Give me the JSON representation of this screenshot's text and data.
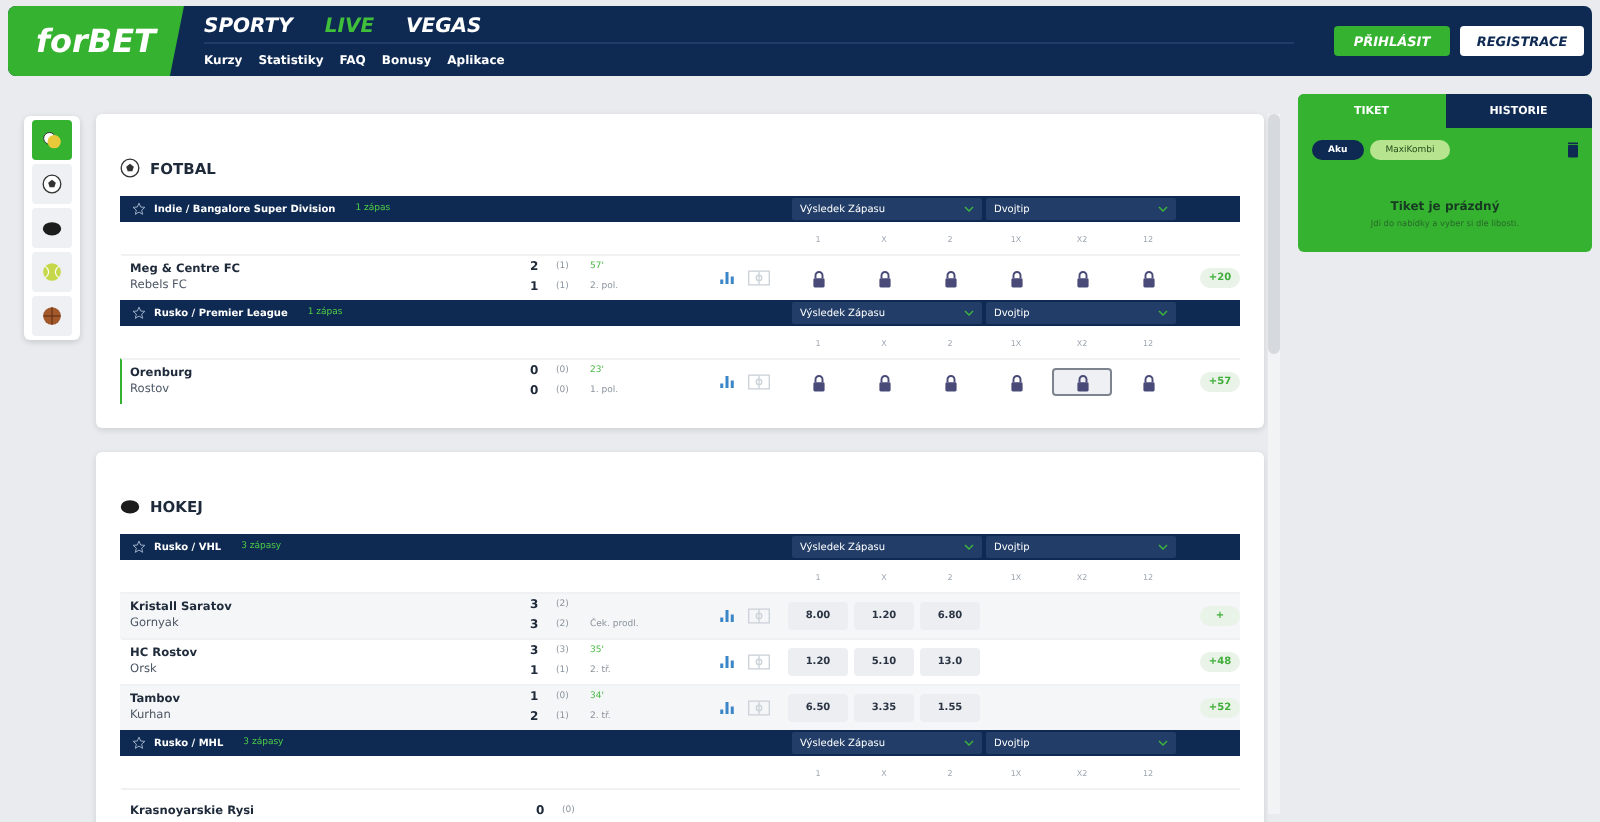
{
  "header": {
    "logo": "forBET",
    "nav": [
      {
        "label": "SPORTY",
        "selected": false
      },
      {
        "label": "LIVE",
        "selected": true
      },
      {
        "label": "VEGAS",
        "selected": false
      }
    ],
    "subnav": [
      "Kurzy",
      "Statistiky",
      "FAQ",
      "Bonusy",
      "Aplikace"
    ],
    "login": "PŘIHLÁSIT",
    "register": "REGISTRACE"
  },
  "sport_menu": [
    {
      "kind": "mixed",
      "selected": true
    },
    {
      "kind": "football",
      "selected": false
    },
    {
      "kind": "hockey",
      "selected": false
    },
    {
      "kind": "tennis",
      "selected": false
    },
    {
      "kind": "basketball",
      "selected": false
    }
  ],
  "sports": [
    {
      "name": "FOTBAL",
      "kind": "football",
      "leagues": [
        {
          "name": "Indie / Bangalore Super Division",
          "count": "1 zápas",
          "markets": [
            "Výsledek Zápasu",
            "Dvojtip"
          ],
          "columns": [
            "1",
            "X",
            "2",
            "1X",
            "X2",
            "12"
          ],
          "matches": [
            {
              "home": "Meg & Centre FC",
              "away": "Rebels FC",
              "home_score": "2",
              "away_score": "1",
              "home_period": "(1)",
              "away_period": "(1)",
              "time": "57'",
              "status": "2. pol.",
              "selected": false,
              "more": "+20",
              "odds": [
                {
                  "kind": "locked",
                  "selected": false
                },
                {
                  "kind": "locked",
                  "selected": false
                },
                {
                  "kind": "locked",
                  "selected": false
                },
                {
                  "kind": "locked",
                  "selected": false
                },
                {
                  "kind": "locked",
                  "selected": false
                },
                {
                  "kind": "locked",
                  "selected": false
                }
              ]
            }
          ]
        },
        {
          "name": "Rusko / Premier League",
          "count": "1 zápas",
          "markets": [
            "Výsledek Zápasu",
            "Dvojtip"
          ],
          "columns": [
            "1",
            "X",
            "2",
            "1X",
            "X2",
            "12"
          ],
          "matches": [
            {
              "home": "Orenburg",
              "away": "Rostov",
              "home_score": "0",
              "away_score": "0",
              "home_period": "(0)",
              "away_period": "(0)",
              "time": "23'",
              "status": "1. pol.",
              "selected": true,
              "more": "+57",
              "odds": [
                {
                  "kind": "locked",
                  "selected": false
                },
                {
                  "kind": "locked",
                  "selected": false
                },
                {
                  "kind": "locked",
                  "selected": false
                },
                {
                  "kind": "locked",
                  "selected": false
                },
                {
                  "kind": "locked",
                  "selected": true
                },
                {
                  "kind": "locked",
                  "selected": false
                }
              ]
            }
          ]
        }
      ]
    },
    {
      "name": "HOKEJ",
      "kind": "hockey",
      "leagues": [
        {
          "name": "Rusko / VHL",
          "count": "3 zápasy",
          "markets": [
            "Výsledek Zápasu",
            "Dvojtip"
          ],
          "columns": [
            "1",
            "X",
            "2",
            "1X",
            "X2",
            "12"
          ],
          "matches": [
            {
              "home": "Kristall Saratov",
              "away": "Gornyak",
              "home_score": "3",
              "away_score": "3",
              "home_period": "(2)",
              "away_period": "(2)",
              "status": "Ček. prodl.",
              "selected": false,
              "more": "+",
              "odds": [
                {
                  "kind": "price",
                  "value": "8.00",
                  "selected": false
                },
                {
                  "kind": "price",
                  "value": "1.20",
                  "selected": false
                },
                {
                  "kind": "price",
                  "value": "6.80",
                  "selected": false
                },
                {
                  "kind": "empty"
                },
                {
                  "kind": "empty"
                },
                {
                  "kind": "empty"
                }
              ]
            },
            {
              "home": "HC Rostov",
              "away": "Orsk",
              "home_score": "3",
              "away_score": "1",
              "home_period": "(3)",
              "away_period": "(1)",
              "time": "35'",
              "status": "2. tř.",
              "selected": false,
              "more": "+48",
              "odds": [
                {
                  "kind": "price",
                  "value": "1.20",
                  "selected": false
                },
                {
                  "kind": "price",
                  "value": "5.10",
                  "selected": false
                },
                {
                  "kind": "price",
                  "value": "13.0",
                  "selected": false
                },
                {
                  "kind": "empty"
                },
                {
                  "kind": "empty"
                },
                {
                  "kind": "empty"
                }
              ]
            },
            {
              "home": "Tambov",
              "away": "Kurhan",
              "home_score": "1",
              "away_score": "2",
              "home_period": "(0)",
              "away_period": "(1)",
              "time": "34'",
              "status": "2. tř.",
              "selected": false,
              "more": "+52",
              "odds": [
                {
                  "kind": "price",
                  "value": "6.50",
                  "selected": false
                },
                {
                  "kind": "price",
                  "value": "3.35",
                  "selected": false
                },
                {
                  "kind": "price",
                  "value": "1.55",
                  "selected": false
                },
                {
                  "kind": "empty"
                },
                {
                  "kind": "empty"
                },
                {
                  "kind": "empty"
                }
              ]
            }
          ]
        },
        {
          "name": "Rusko / MHL",
          "count": "3 zápasy",
          "markets": [
            "Výsledek Zápasu",
            "Dvojtip"
          ],
          "columns": [
            "1",
            "X",
            "2",
            "1X",
            "X2",
            "12"
          ],
          "matches": [
            {
              "home": "Krasnoyarskie Rysi",
              "home_score": "0",
              "home_period": "(0)",
              "selected": false
            }
          ]
        }
      ]
    }
  ],
  "ticket": {
    "tabs": [
      {
        "label": "TIKET",
        "selected": true
      },
      {
        "label": "HISTORIE",
        "selected": false
      }
    ],
    "modes": [
      {
        "label": "Aku",
        "selected": true
      },
      {
        "label": "MaxiKombi",
        "selected": false
      }
    ],
    "empty_title": "Tiket je prázdný",
    "empty_text": "Jdi do nabídky a vyber si dle libosti."
  }
}
